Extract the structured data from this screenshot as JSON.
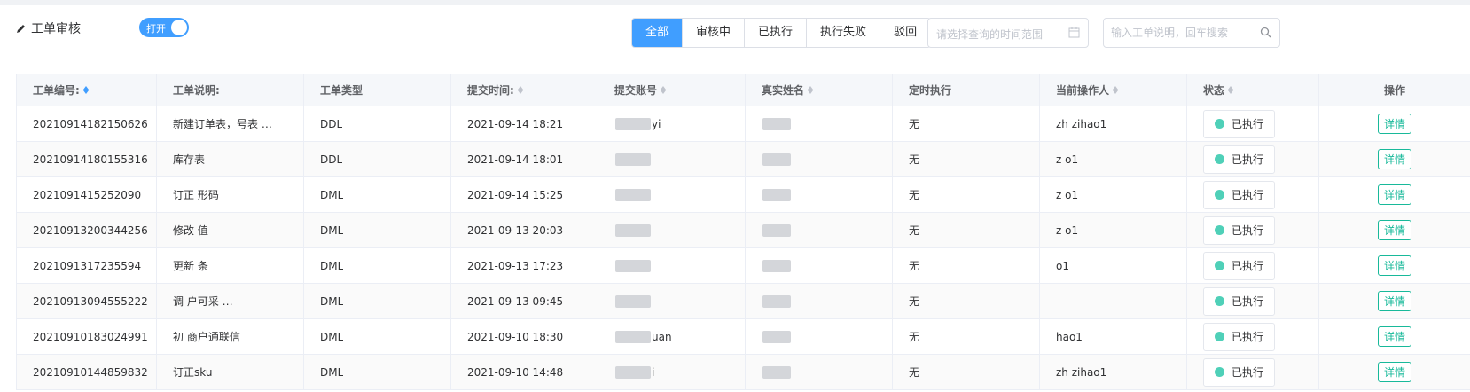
{
  "header": {
    "title": "工单审核",
    "switch_label": "打开",
    "filters": [
      "全部",
      "审核中",
      "已执行",
      "执行失败",
      "驳回"
    ],
    "active_filter": "全部",
    "date_placeholder": "请选择查询的时间范围",
    "search_placeholder": "输入工单说明，回车搜索"
  },
  "table": {
    "columns": [
      "工单编号:",
      "工单说明:",
      "工单类型",
      "提交时间:",
      "提交账号",
      "真实姓名",
      "定时执行",
      "当前操作人",
      "状态",
      "操作"
    ],
    "rows": [
      {
        "id": "20210914182150626",
        "desc": "新建订单表，号表 …",
        "type": "DDL",
        "time": "2021-09-14 18:21",
        "account": "yi",
        "name": "",
        "timed": "无",
        "operator": "zh   zihao1",
        "status": "已执行",
        "action": "详情"
      },
      {
        "id": "20210914180155316",
        "desc": "     库存表",
        "type": "DDL",
        "time": "2021-09-14 18:01",
        "account": "",
        "name": "",
        "timed": "无",
        "operator": "z      o1",
        "status": "已执行",
        "action": "详情"
      },
      {
        "id": "2021091415252090",
        "desc": "订正    形码",
        "type": "DML",
        "time": "2021-09-14 15:25",
        "account": "",
        "name": "",
        "timed": "无",
        "operator": "z      o1",
        "status": "已执行",
        "action": "详情"
      },
      {
        "id": "20210913200344256",
        "desc": "修改     值",
        "type": "DML",
        "time": "2021-09-13 20:03",
        "account": "",
        "name": "",
        "timed": "无",
        "operator": "z      o1",
        "status": "已执行",
        "action": "详情"
      },
      {
        "id": "2021091317235594",
        "desc": "更新   条",
        "type": "DML",
        "time": "2021-09-13 17:23",
        "account": "",
        "name": "",
        "timed": "无",
        "operator": "      o1",
        "status": "已执行",
        "action": "详情"
      },
      {
        "id": "20210913094555222",
        "desc": "调   户可采   …",
        "type": "DML",
        "time": "2021-09-13 09:45",
        "account": "",
        "name": "",
        "timed": "无",
        "operator": "",
        "status": "已执行",
        "action": "详情"
      },
      {
        "id": "20210910183024991",
        "desc": "初   商户通联信",
        "type": "DML",
        "time": "2021-09-10 18:30",
        "account": "uan",
        "name": "",
        "timed": "无",
        "operator": "      hao1",
        "status": "已执行",
        "action": "详情"
      },
      {
        "id": "20210910144859832",
        "desc": "订正sku",
        "type": "DML",
        "time": "2021-09-10 14:48",
        "account": "i",
        "name": "",
        "timed": "无",
        "operator": "zh   zihao1",
        "status": "已执行",
        "action": "详情"
      }
    ]
  },
  "colors": {
    "primary": "#409eff",
    "success_dot": "#4fd0b8",
    "detail": "#18b99a"
  }
}
